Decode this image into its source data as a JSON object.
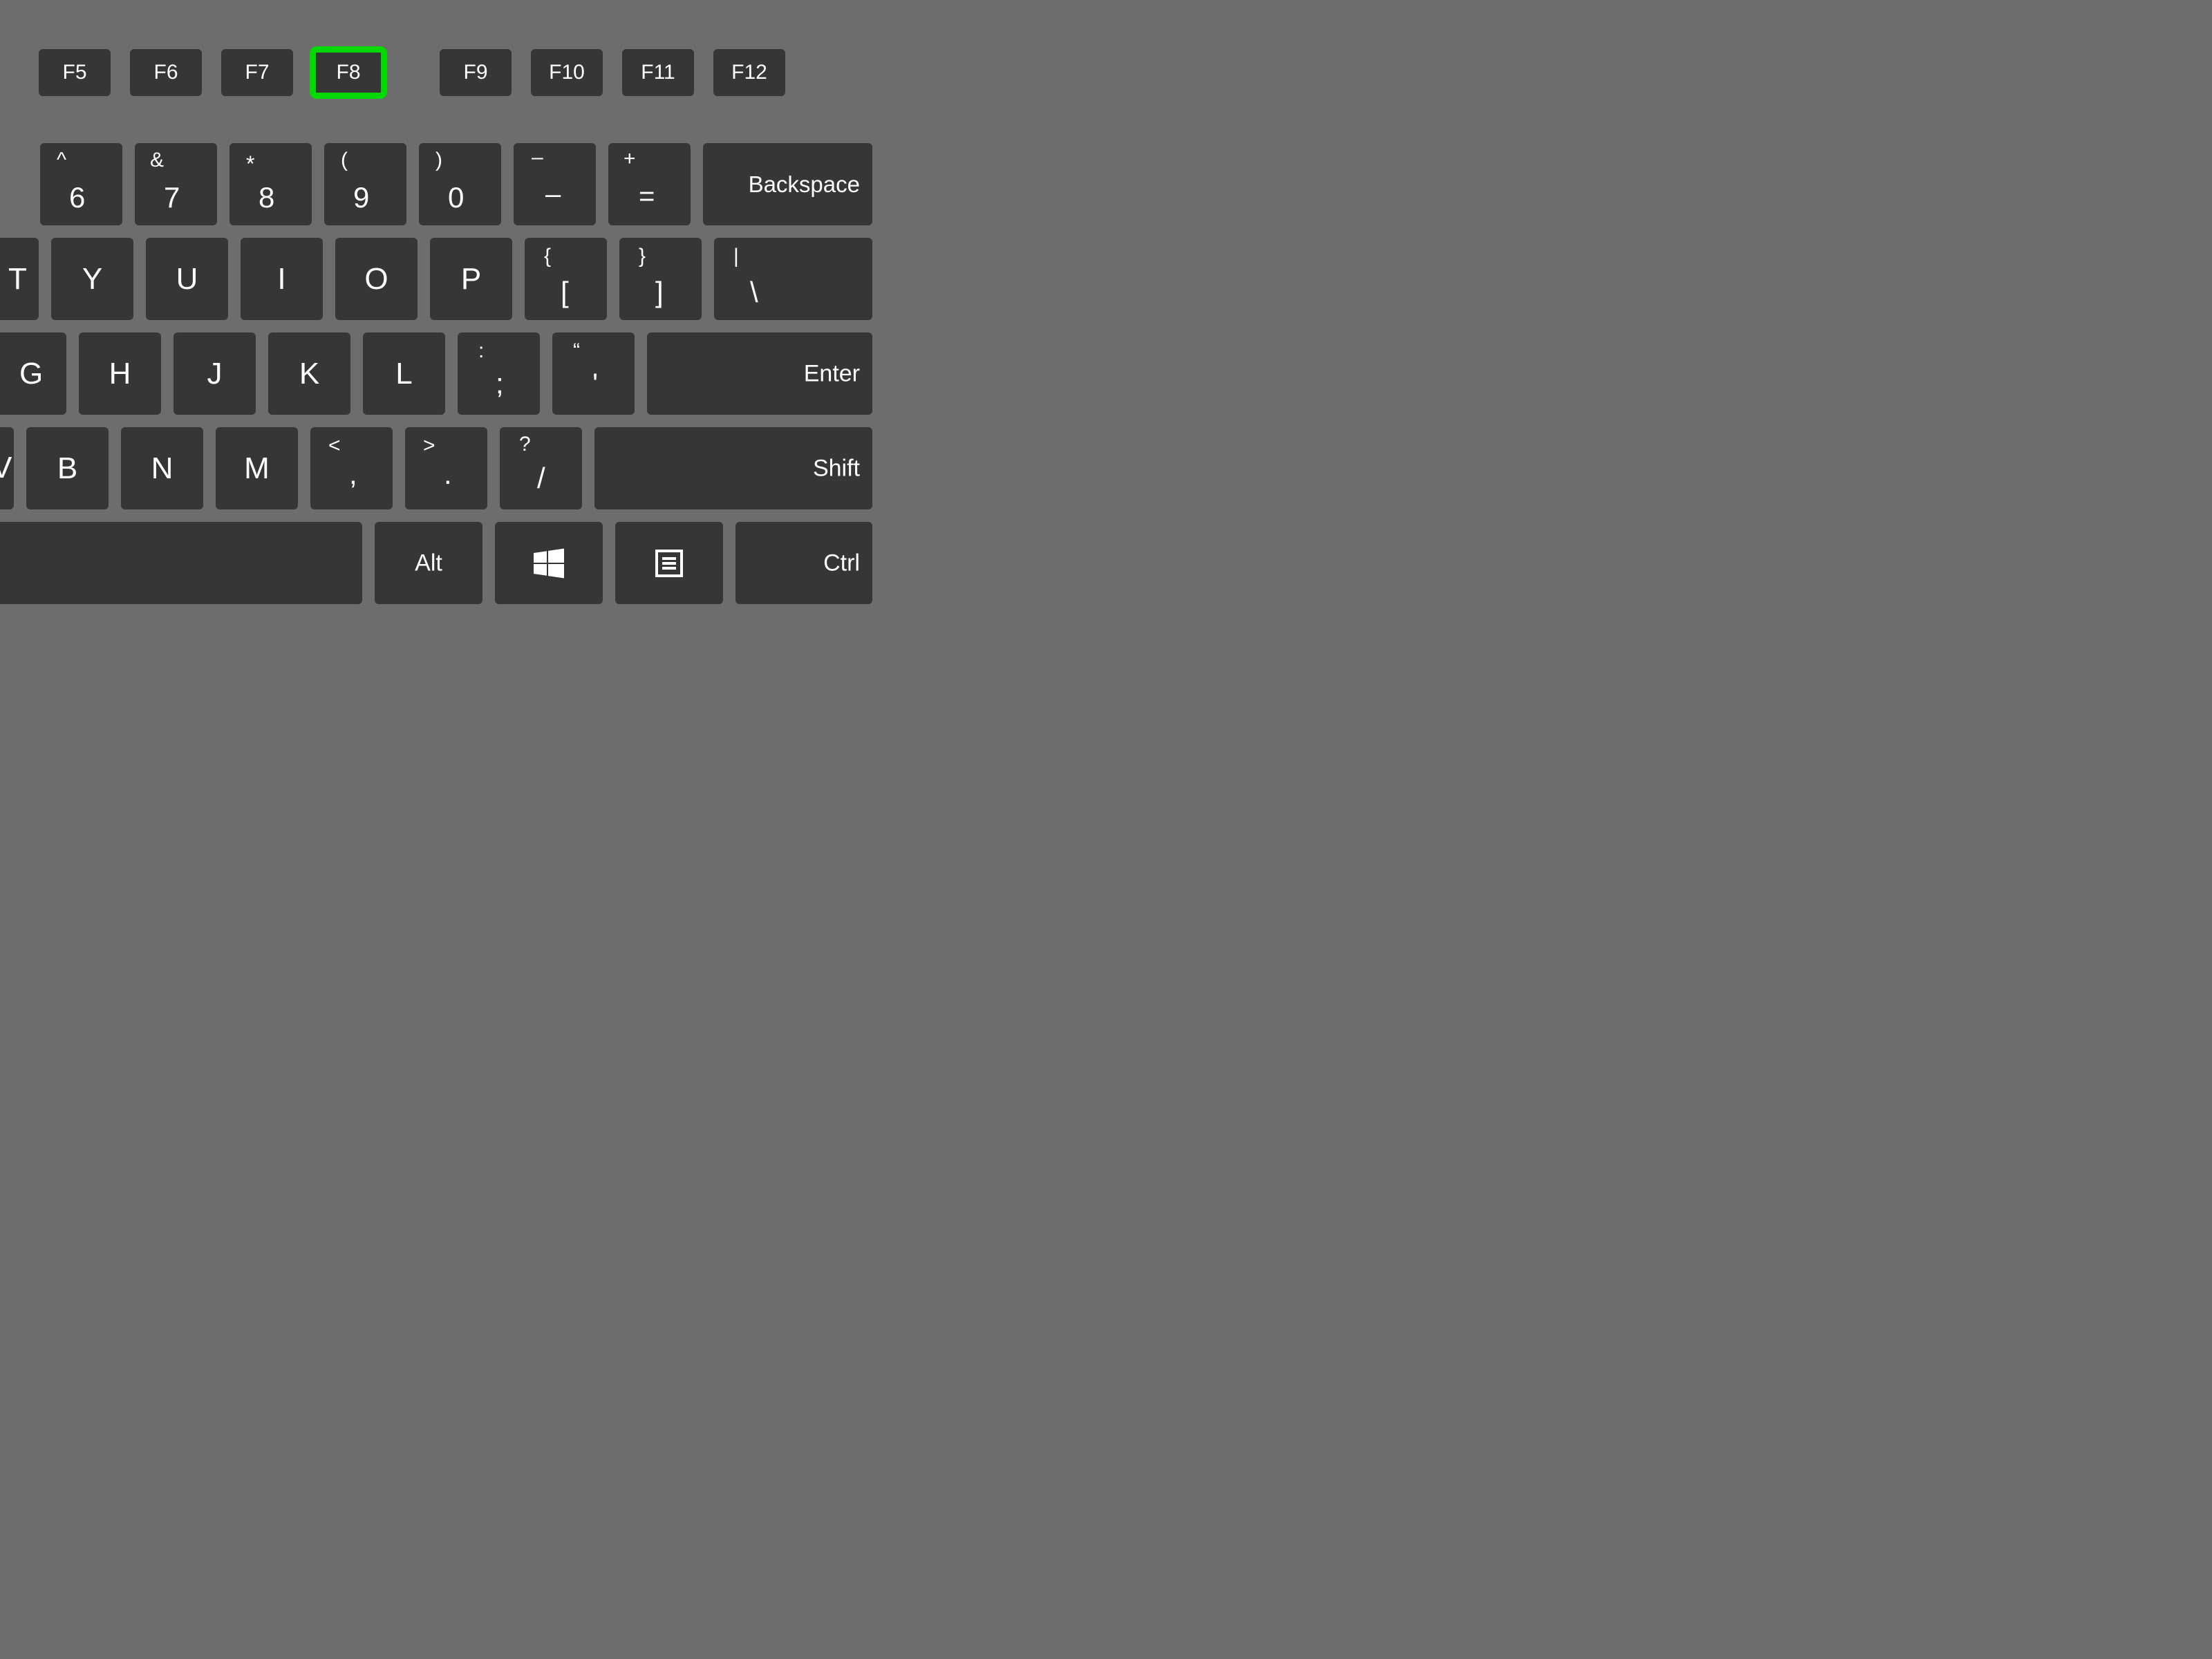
{
  "colors": {
    "bg": "#6d6d6d",
    "key": "#363636",
    "text": "#ffffff",
    "highlight": "#00d800"
  },
  "highlighted_key": "F8",
  "keys": {
    "f5": "F5",
    "f6": "F6",
    "f7": "F7",
    "f8": "F8",
    "f9": "F9",
    "f10": "F10",
    "f11": "F11",
    "f12": "F12",
    "num6_sup": "^",
    "num6": "6",
    "num7_sup": "&",
    "num7": "7",
    "num8_sup": "*",
    "num8": "8",
    "num9_sup": "(",
    "num9": "9",
    "num0_sup": ")",
    "num0": "0",
    "minus_sup": "–",
    "minus": "–",
    "equals_sup": "+",
    "equals": "=",
    "backspace": "Backspace",
    "t": "T",
    "y": "Y",
    "u": "U",
    "i": "I",
    "o": "O",
    "p": "P",
    "lbrack_sup": "{",
    "lbrack": "[",
    "rbrack_sup": "}",
    "rbrack": "]",
    "bslash_sup": "|",
    "bslash": "\\",
    "g": "G",
    "h": "H",
    "j": "J",
    "k": "K",
    "l": "L",
    "semi_sup": ":",
    "semi": ";",
    "quote_sup": "“",
    "quote": "'",
    "enter": "Enter",
    "v": "V",
    "b": "B",
    "n": "N",
    "m": "M",
    "comma_sup": "<",
    "comma": ",",
    "period_sup": ">",
    "period": ".",
    "slash_sup": "?",
    "slash": "/",
    "shift": "Shift",
    "alt": "Alt",
    "windows_icon": "windows-icon",
    "menu_icon": "menu-icon",
    "ctrl": "Ctrl"
  }
}
